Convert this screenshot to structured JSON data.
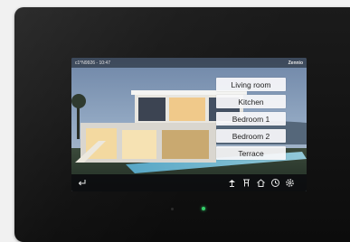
{
  "status_bar": {
    "left_text": "c1°N9926 - 10:47",
    "brand": "Zennio"
  },
  "rooms": [
    {
      "label": "Living room"
    },
    {
      "label": "Kitchen"
    },
    {
      "label": "Bedroom 1"
    },
    {
      "label": "Bedroom 2"
    },
    {
      "label": "Terrace"
    }
  ],
  "bottom_bar": {
    "icons": [
      "back-arrow-icon",
      "lamp-icon",
      "blinds-icon",
      "home-icon",
      "clock-icon",
      "settings-icon"
    ]
  },
  "colors": {
    "device_body": "#151515",
    "status_led": "#35d06a",
    "room_button_bg": "#f8f8fa"
  }
}
